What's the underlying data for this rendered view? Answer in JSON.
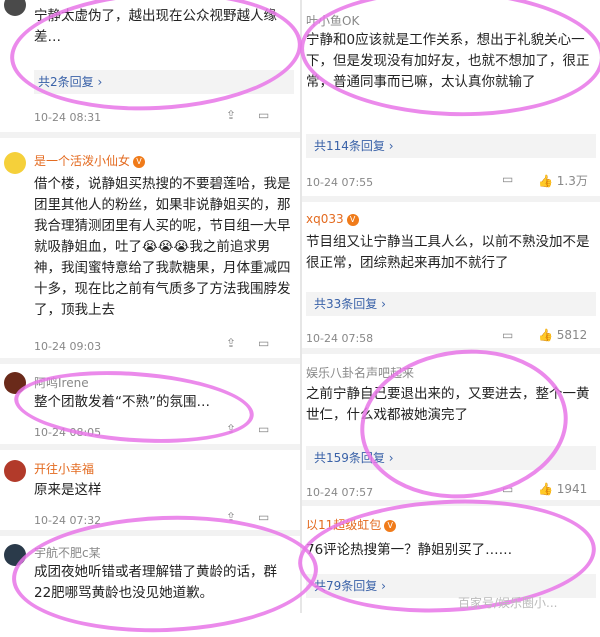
{
  "left": {
    "c1": {
      "text": "宁静太虚伪了，越出现在公众视野越人缘差…",
      "reply": "共2条回复 ›",
      "time": "10-24 08:31"
    },
    "c2": {
      "name": "是一个活泼小仙女",
      "text": "借个楼，说静姐买热搜的不要碧莲哈，我是团里其他人的粉丝，如果非说静姐买的，那我合理猜测团里有人买的呢，节目组一大早就吸静姐血，吐了😭😭😭我之前追求男神，我闺蜜特意给了我款糖果，月体重减四十多，现在比之前有气质多了方法我围脖发了，顶我上去",
      "time": "10-24 09:03"
    },
    "c3": {
      "name": "阿鸣Irene",
      "text": "整个团散发着“不熟”的氛围…",
      "time": "10-24 08:05"
    },
    "c4": {
      "name": "开往小幸福",
      "text": "原来是这样",
      "time": "10-24 07:32"
    },
    "c5": {
      "name": "宇航不肥c某",
      "text": "成团夜她听错或者理解错了黄龄的话，群22肥哪骂黄龄也没见她道歉。"
    }
  },
  "right": {
    "r1": {
      "name": "叶小鱼OK",
      "text": "宁静和0应该就是工作关系，想出于礼貌关心一下，但是发现没有加好友，也就不想加了，很正常，普通同事而已嘛，太认真你就输了",
      "reply": "共114条回复 ›",
      "time": "10-24 07:55",
      "likes": "1.3万"
    },
    "r2": {
      "name": "xq033",
      "text": "节目组又让宁静当工具人么，以前不熟没加不是很正常，团综熟起来再加不就行了",
      "reply": "共33条回复 ›",
      "time": "10-24 07:58",
      "likes": "5812"
    },
    "r3": {
      "name": "娱乐八卦名声吧起来",
      "text": "之前宁静自己要退出来的，又要进去，整个一黄世仁，什么戏都被她演完了",
      "reply": "共159条回复 ›",
      "time": "10-24 07:57",
      "likes": "1941"
    },
    "r4": {
      "name": "以11超级虹包",
      "text": "76评论热搜第一？静姐别买了……",
      "reply": "共79条回复 ›"
    }
  },
  "watermark": "百家号/娱乐圈小...",
  "colors": {
    "username": "#e36a1f",
    "reply_link": "#3a62a8",
    "highlight": "#e876e8"
  }
}
